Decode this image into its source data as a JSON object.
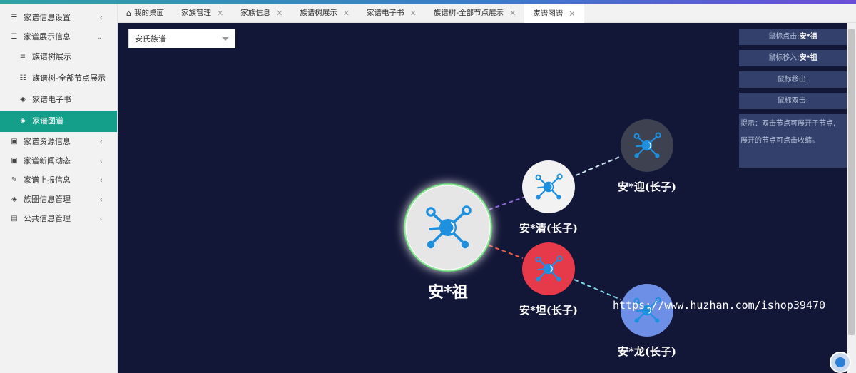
{
  "sidebar": {
    "items": [
      {
        "label": "家谱信息设置",
        "icon": "list-icon",
        "arrow": "‹"
      },
      {
        "label": "家谱展示信息",
        "icon": "list-icon",
        "arrow": "⌄"
      },
      {
        "label": "族谱树展示",
        "icon": "lines-icon"
      },
      {
        "label": "族谱树-全部节点展示",
        "icon": "tree-icon"
      },
      {
        "label": "家谱电子书",
        "icon": "cube-icon"
      },
      {
        "label": "家谱图谱",
        "icon": "cube-icon"
      },
      {
        "label": "家谱资源信息",
        "icon": "grid-icon",
        "arrow": "‹"
      },
      {
        "label": "家谱新闻动态",
        "icon": "grid-icon",
        "arrow": "‹"
      },
      {
        "label": "家谱上报信息",
        "icon": "pencil-icon",
        "arrow": "‹"
      },
      {
        "label": "族圈信息管理",
        "icon": "cube-icon",
        "arrow": "‹"
      },
      {
        "label": "公共信息管理",
        "icon": "doc-icon",
        "arrow": "‹"
      }
    ]
  },
  "tabs": [
    {
      "label": "我的桌面"
    },
    {
      "label": "家族管理",
      "close": "✕"
    },
    {
      "label": "家族信息",
      "close": "✕"
    },
    {
      "label": "族谱树展示",
      "close": "✕"
    },
    {
      "label": "家谱电子书",
      "close": "✕"
    },
    {
      "label": "族谱树-全部节点展示",
      "close": "✕"
    },
    {
      "label": "家谱图谱",
      "close": "✕"
    }
  ],
  "select": {
    "value": "安氏族谱"
  },
  "info": {
    "click_prefix": "鼠标点击:",
    "click_value": "安*祖",
    "hover_prefix": "鼠标移入:",
    "hover_value": "安*祖",
    "out_label": "鼠标移出:",
    "dbl_label": "鼠标双击:",
    "tip_line1": "提示：双击节点可展开子节点,",
    "tip_line2": "展开的节点可点击收缩。"
  },
  "graph": {
    "nodes": {
      "root": {
        "label": "安*祖",
        "color": "#e6e6e6"
      },
      "qing": {
        "label": "安*清(长子)",
        "color": "#f2f2f2"
      },
      "tan": {
        "label": "安*坦(长子)",
        "color": "#e63a4a"
      },
      "ying": {
        "label": "安*迎(长子)",
        "color": "#3d4150"
      },
      "long": {
        "label": "安*龙(长子)",
        "color": "#6e8fe6"
      }
    },
    "icon_color": "#1e90e0"
  },
  "watermark": "https://www.huzhan.com/ishop39470",
  "colors": {
    "accent": "#149f8a",
    "canvas": "#131737",
    "panel": "#32406b"
  }
}
